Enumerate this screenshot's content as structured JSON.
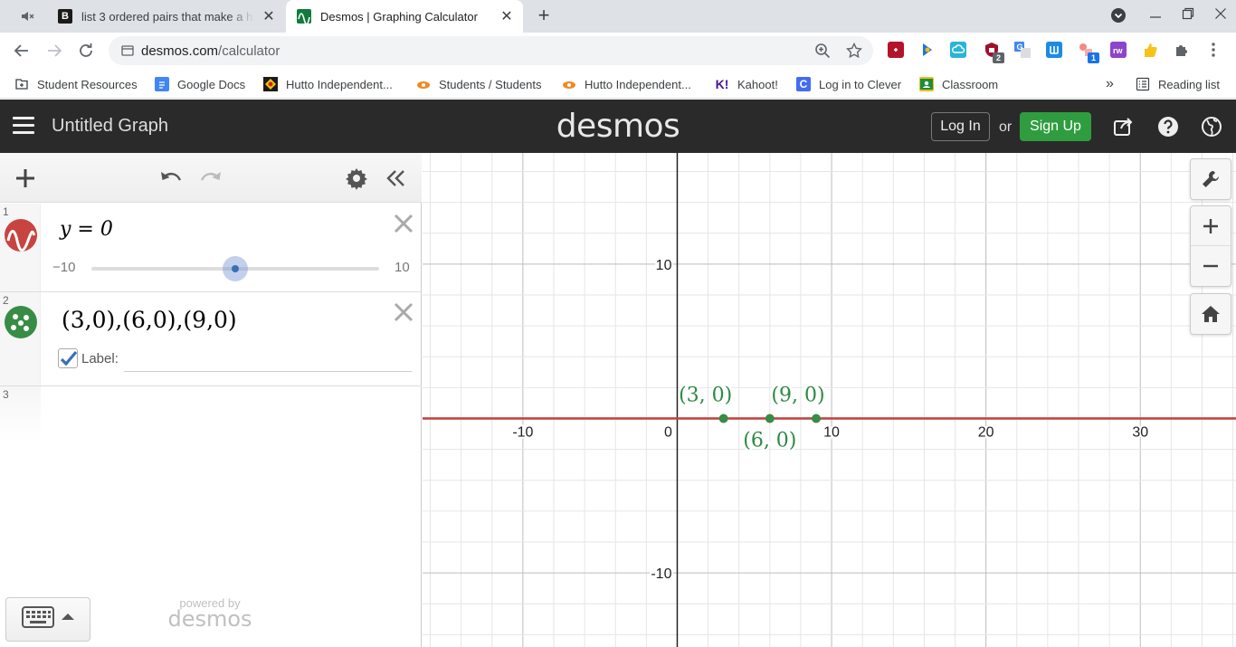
{
  "browser": {
    "tabs": [
      {
        "title": "list 3 ordered pairs that make a h",
        "favicon": "B",
        "active": false
      },
      {
        "title": "Desmos | Graphing Calculator",
        "active": true
      }
    ],
    "url_host": "desmos.com",
    "url_path": "/calculator",
    "bookmarks": [
      {
        "label": "Student Resources",
        "icon": "bookmark-page-icon"
      },
      {
        "label": "Google Docs",
        "icon": "docs-icon"
      },
      {
        "label": "Hutto Independent...",
        "icon": "hutto-icon"
      },
      {
        "label": "Students / Students",
        "icon": "classlink-icon"
      },
      {
        "label": "Hutto Independent...",
        "icon": "classlink-icon"
      },
      {
        "label": "Kahoot!",
        "icon": "kahoot-icon"
      },
      {
        "label": "Log in to Clever",
        "icon": "clever-icon"
      },
      {
        "label": "Classroom",
        "icon": "classroom-icon"
      }
    ],
    "overflow": "»",
    "reading_list": "Reading list",
    "extension_badges": [
      "2",
      "1"
    ]
  },
  "desmos": {
    "graph_title": "Untitled Graph",
    "logo": "desmos",
    "login": "Log In",
    "or": "or",
    "signup": "Sign Up",
    "powered_by": "powered by",
    "powered_logo": "desmos",
    "expressions": [
      {
        "index": "1",
        "latex": "y = 0",
        "color": "#c74440",
        "slider_min": "−10",
        "slider_max": "10",
        "slider_value": 0
      },
      {
        "index": "2",
        "latex": "(3,0),(6,0),(9,0)",
        "color": "#388c46",
        "label_checkbox": "Label:",
        "label_value": ""
      },
      {
        "index": "3",
        "latex": ""
      }
    ]
  },
  "chart_data": {
    "type": "scatter",
    "x_ticks": [
      "-10",
      "0",
      "10",
      "20",
      "30"
    ],
    "y_ticks": [
      "10",
      "-10"
    ],
    "xlim": [
      -16.5,
      36.2
    ],
    "ylim": [
      -14.8,
      17.2
    ],
    "grid": true,
    "line": {
      "equation": "y = 0",
      "color": "#c74440"
    },
    "points": [
      {
        "x": 3,
        "y": 0,
        "label": "(3, 0)"
      },
      {
        "x": 6,
        "y": 0,
        "label": "(6, 0)"
      },
      {
        "x": 9,
        "y": 0,
        "label": "(9, 0)"
      }
    ],
    "point_color": "#388c46"
  }
}
